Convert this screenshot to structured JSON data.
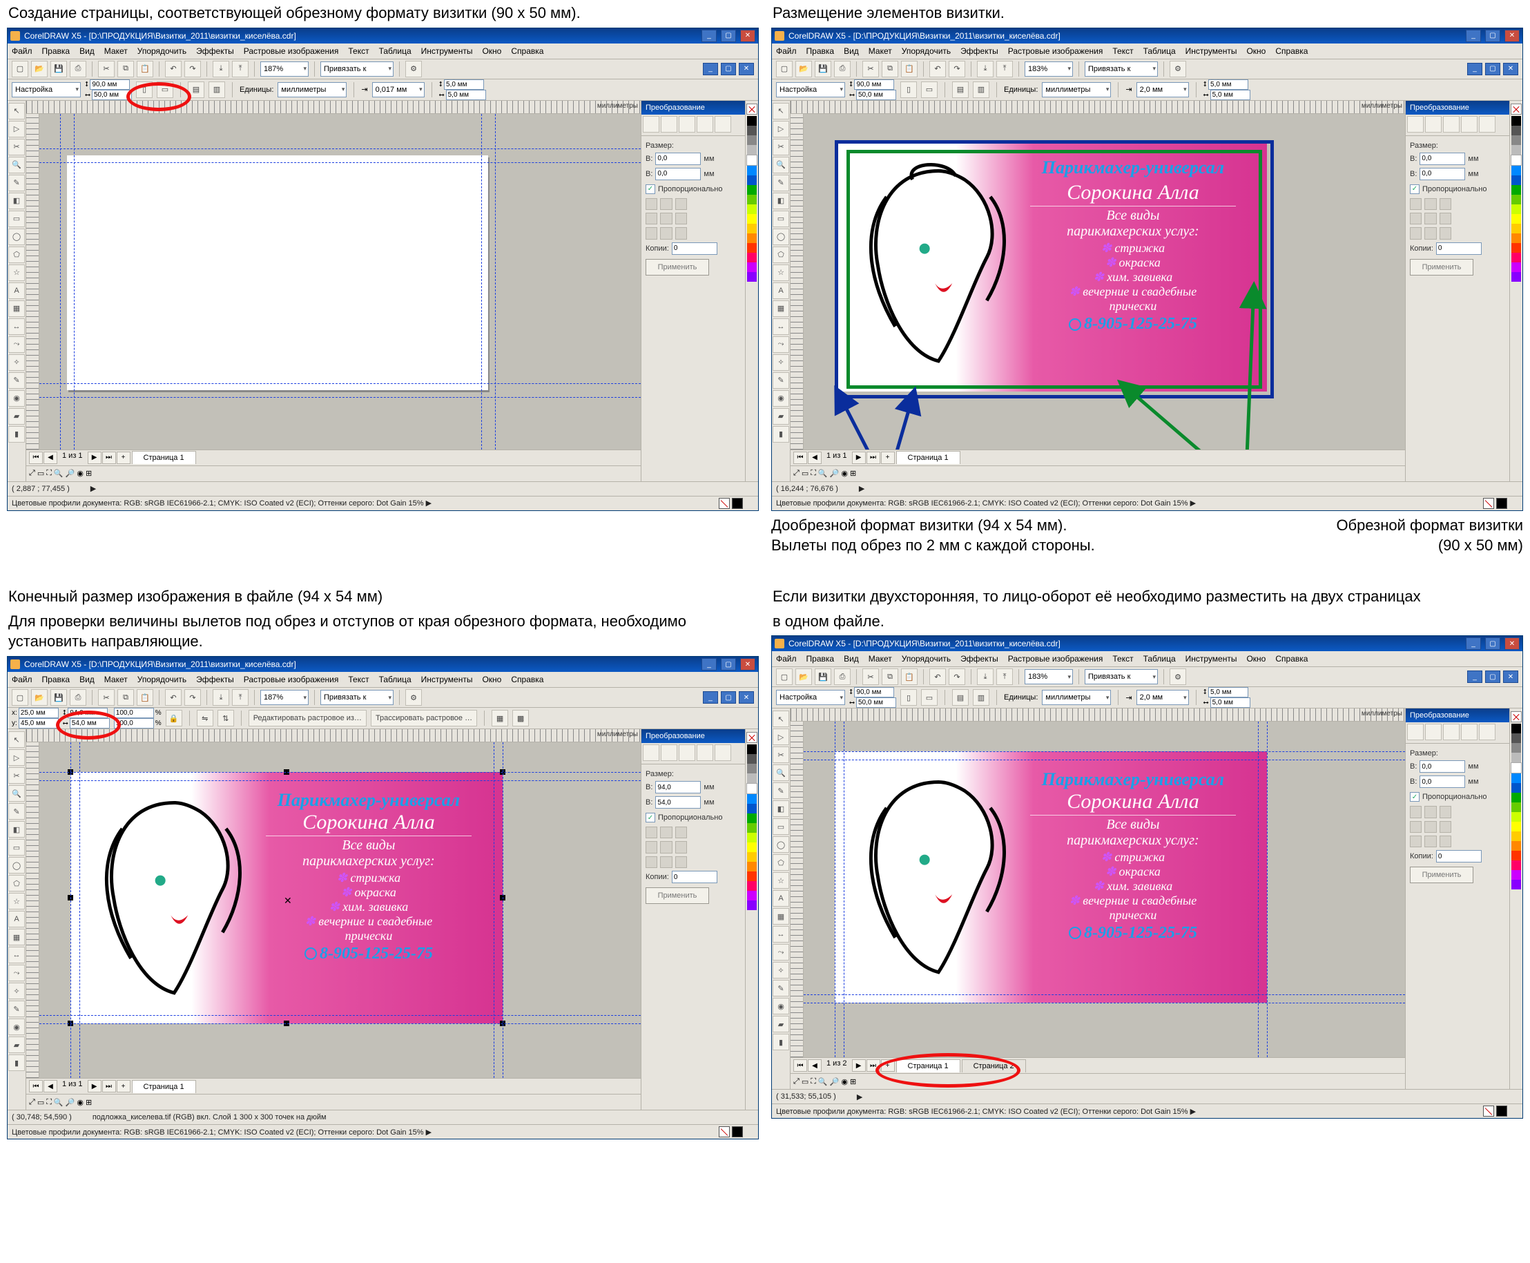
{
  "captions": {
    "p1": "Создание страницы, соответствующей обрезному формату визитки (90 х 50 мм).",
    "p2": "Размещение элементов визитки.",
    "p2ann1": "Дообрезной формат визитки (94 х 54 мм).",
    "p2ann2": "Вылеты под обрез по 2 мм с каждой стороны.",
    "p2ann3": "Обрезной формат визитки",
    "p2ann4": "(90 х 50 мм)",
    "p3a": "Конечный размер изображения в файле (94 х 54 мм)",
    "p3b": "Для проверки величины вылетов под обрез и отступов от края обрезного формата, необходимо установить направляющие.",
    "p4a": "Если визитки двухсторонняя, то лицо-оборот её необходимо разместить на двух страницах",
    "p4b": "в одном файле."
  },
  "app": {
    "title": "CorelDRAW X5 - [D:\\ПРОДУКЦИЯ\\Визитки_2011\\визитки_киселёва.cdr]",
    "menu": [
      "Файл",
      "Правка",
      "Вид",
      "Макет",
      "Упорядочить",
      "Эффекты",
      "Растровые изображения",
      "Текст",
      "Таблица",
      "Инструменты",
      "Окно",
      "Справка"
    ],
    "zoom1": "187%",
    "zoom3": "187%",
    "zoom2": "183%",
    "zoom4": "183%",
    "snapLabel": "Привязать к",
    "unitsLabel": "Единицы:",
    "units": "миллиметры",
    "rulerUnit": "миллиметры",
    "propLeft1": "Настройка",
    "pageW1": "90,0 мм",
    "pageH1": "50,0 мм",
    "pageW2": "90,0 мм",
    "pageH2": "50,0 мм",
    "nudge1": "0,017 мм",
    "nudge2": "2,0 мм",
    "dup": "5,0 мм",
    "p3xy": {
      "xlabel": "x:",
      "ylabel": "y:",
      "x": "25,0 мм",
      "y": "45,0 мм",
      "w": "94,0 мм",
      "h": "54,0 мм",
      "sx": "100,0",
      "sy": "100,0",
      "pct": "%"
    },
    "p3btns": {
      "edit": "Редактировать растровое из…",
      "trace": "Трассировать растровое …"
    },
    "docker": {
      "title": "Преобразование",
      "size": "Размер:",
      "prop": "Пропорционально",
      "copies": "Копии:",
      "apply": "Применить",
      "w": "В:",
      "h": "В:",
      "mm": "мм",
      "v0": "0,0",
      "v94": "94,0",
      "v54": "54,0",
      "c0": "0"
    },
    "pageNav": {
      "fmt1": "1 из 1",
      "fmt2": "1 из 2",
      "plus": "+"
    },
    "tabs": {
      "p1": "Страница 1",
      "p2": "Страница 2"
    },
    "status": {
      "coord1": "( 2,887 ; 77,455 )",
      "coord2": "( 16,244 ; 76,676 )",
      "coord3": "( 30,748; 54,590 )",
      "coord4": "( 31,533; 55,105 )",
      "mid3": "подложка_киселева.tif (RGB) вкл. Слой 1 300 x 300 точек на дюйм",
      "next": "▶",
      "doc": "Цветовые профили документа: RGB: sRGB IEC61966-2.1; CMYK: ISO Coated v2 (ECI); Оттенки серого: Dot Gain 15% ▶"
    },
    "biz": {
      "t1": "Парикмахер-универсал",
      "t2": "Сорокина Алла",
      "t3": "Все виды\nпарикмахерских услуг:",
      "li": [
        "стрижка",
        "окраска",
        "хим. завивка",
        "вечерние и свадебные\nпрически"
      ],
      "phone": "8-905-125-25-75"
    }
  },
  "colors": [
    "#000",
    "#666",
    "#999",
    "#ccc",
    "#fff",
    "#08f",
    "#06c",
    "#03a",
    "#0a0",
    "#6c0",
    "#cf0",
    "#ff0",
    "#fc0",
    "#f80",
    "#f40",
    "#f06",
    "#c0f",
    "#80f"
  ]
}
